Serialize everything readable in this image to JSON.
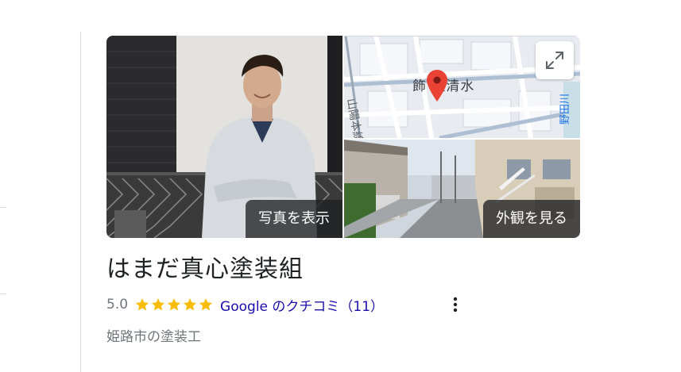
{
  "photos": {
    "main_overlay_label": "写真を表示",
    "street_overlay_label": "外観を見る"
  },
  "map": {
    "place_label": "飾 区清水",
    "street_label_left": "山陽本線",
    "street_label_right": "野田川"
  },
  "business": {
    "name": "はまだ真心塗装組",
    "rating": "5.0",
    "star_count": 5,
    "reviews_link": "Google のクチコミ（11）",
    "category": "姫路市の塗装工"
  },
  "colors": {
    "star": "#fbbc04",
    "link": "#1a0dab",
    "pin": "#ea4335",
    "secondary_text": "#70757a",
    "title_text": "#202124"
  },
  "icons": {
    "expand": "expand-icon",
    "more": "more-vert-icon",
    "pin": "map-pin-icon",
    "star": "star-icon"
  }
}
